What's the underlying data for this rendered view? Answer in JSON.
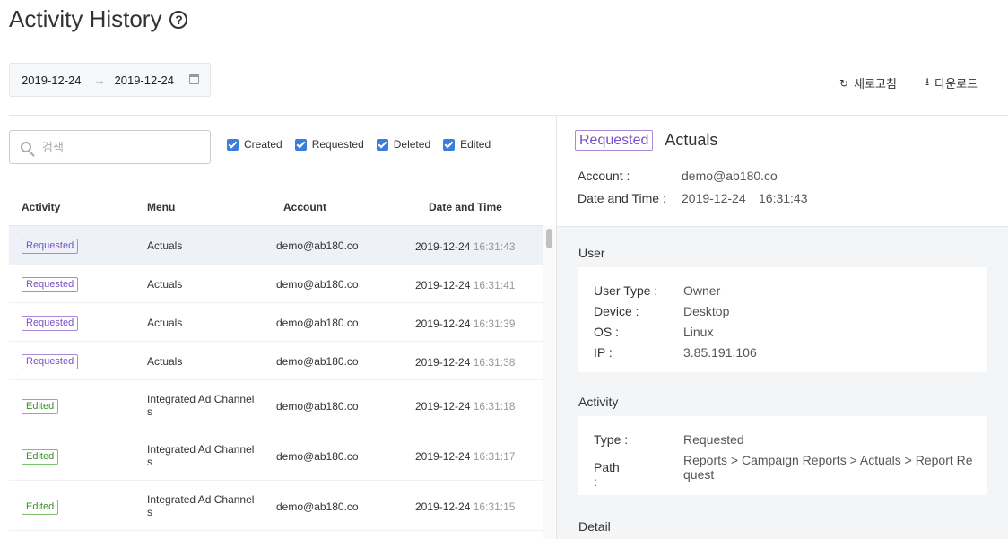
{
  "page": {
    "title": "Activity History"
  },
  "date_range": {
    "from": "2019-12-24",
    "to": "2019-12-24"
  },
  "actions": {
    "refresh_label": "새로고침",
    "download_label": "다운로드"
  },
  "search": {
    "placeholder": "검색"
  },
  "filters": [
    {
      "label": "Created",
      "checked": true
    },
    {
      "label": "Requested",
      "checked": true
    },
    {
      "label": "Deleted",
      "checked": true
    },
    {
      "label": "Edited",
      "checked": true
    }
  ],
  "table": {
    "columns": [
      "Activity",
      "Menu",
      "Account",
      "Date and Time"
    ],
    "rows": [
      {
        "activity": "Requested",
        "menu": "Actuals",
        "account": "demo@ab180.co",
        "date": "2019-12-24",
        "time": "16:31:43",
        "selected": true
      },
      {
        "activity": "Requested",
        "menu": "Actuals",
        "account": "demo@ab180.co",
        "date": "2019-12-24",
        "time": "16:31:41"
      },
      {
        "activity": "Requested",
        "menu": "Actuals",
        "account": "demo@ab180.co",
        "date": "2019-12-24",
        "time": "16:31:39"
      },
      {
        "activity": "Requested",
        "menu": "Actuals",
        "account": "demo@ab180.co",
        "date": "2019-12-24",
        "time": "16:31:38"
      },
      {
        "activity": "Edited",
        "menu": "Integrated Ad Channel\ns",
        "account": "demo@ab180.co",
        "date": "2019-12-24",
        "time": "16:31:18"
      },
      {
        "activity": "Edited",
        "menu": "Integrated Ad Channel\ns",
        "account": "demo@ab180.co",
        "date": "2019-12-24",
        "time": "16:31:17"
      },
      {
        "activity": "Edited",
        "menu": "Integrated Ad Channel\ns",
        "account": "demo@ab180.co",
        "date": "2019-12-24",
        "time": "16:31:15"
      }
    ]
  },
  "detail": {
    "badge": "Requested",
    "title": "Actuals",
    "account_label": "Account :",
    "account_value": "demo@ab180.co",
    "datetime_label": "Date and Time :",
    "date_value": "2019-12-24",
    "time_value": "16:31:43",
    "user": {
      "section_title": "User",
      "user_type_label": "User Type :",
      "user_type": "Owner",
      "device_label": "Device :",
      "device": "Desktop",
      "os_label": "OS :",
      "os": "Linux",
      "ip_label": "IP :",
      "ip": "3.85.191.106"
    },
    "activity": {
      "section_title": "Activity",
      "type_label": "Type :",
      "type": "Requested",
      "path_label": "Path :",
      "path": "Reports > Campaign Reports > Actuals > Report Re\nquest"
    },
    "detail_section_title": "Detail"
  },
  "colors": {
    "requested": "#7b4fc6",
    "edited": "#3a8f2a",
    "checkbox": "#3b7ddd"
  }
}
